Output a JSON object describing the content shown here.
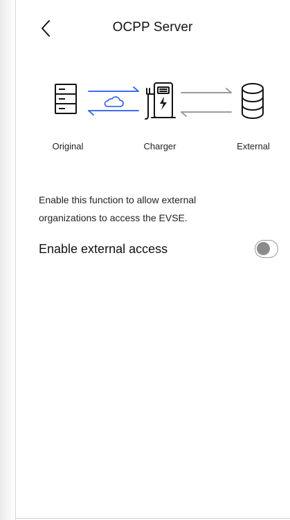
{
  "header": {
    "title": "OCPP Server",
    "back_icon": "chevron-left-icon"
  },
  "diagram": {
    "nodes": [
      {
        "label": "Original",
        "icon": "server-stack-icon"
      },
      {
        "label": "Charger",
        "icon": "ev-charger-icon"
      },
      {
        "label": "External",
        "icon": "database-icon"
      }
    ],
    "links": [
      {
        "from": "Original",
        "to": "Charger",
        "color": "#3b6cf0",
        "icon": "cloud-icon"
      },
      {
        "from": "Charger",
        "to": "External",
        "color": "#9a9a9a"
      }
    ]
  },
  "description": {
    "line1": "Enable this function to allow external",
    "line2": "organizations to access the EVSE."
  },
  "external_access": {
    "label": "Enable external access",
    "enabled": false
  },
  "colors": {
    "accent_blue": "#3b6cf0",
    "inactive_gray": "#9a9a9a",
    "text": "#111111"
  }
}
